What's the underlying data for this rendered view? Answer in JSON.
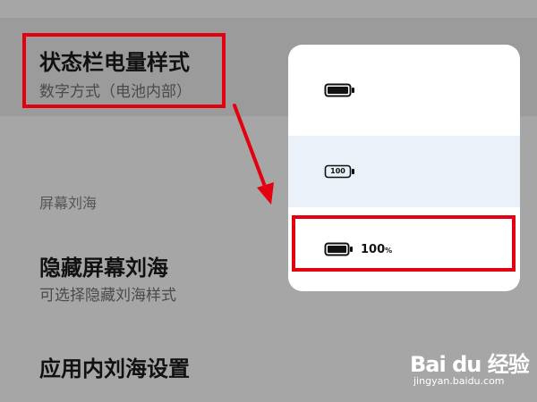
{
  "battery_setting": {
    "title": "状态栏电量样式",
    "subtitle": "数字方式（电池内部）"
  },
  "section_header": "屏幕刘海",
  "hide_notch": {
    "title": "隐藏屏幕刘海",
    "subtitle": "可选择隐藏刘海样式"
  },
  "app_notch": {
    "title": "应用内刘海设置"
  },
  "dropdown": {
    "options": [
      {
        "icon": "battery-plain-icon",
        "text": ""
      },
      {
        "icon": "battery-number-inside-icon",
        "inner_text": "100",
        "selected": true
      },
      {
        "icon": "battery-with-percent-icon",
        "text": "100",
        "suffix": "%"
      }
    ]
  },
  "watermark": {
    "logo_text": "Bai du 经验",
    "url": "jingyan.baidu.com"
  },
  "colors": {
    "accent_red": "#e3000f",
    "selected_bg": "#eaf1f8",
    "overlay": "#a6a6a6"
  }
}
